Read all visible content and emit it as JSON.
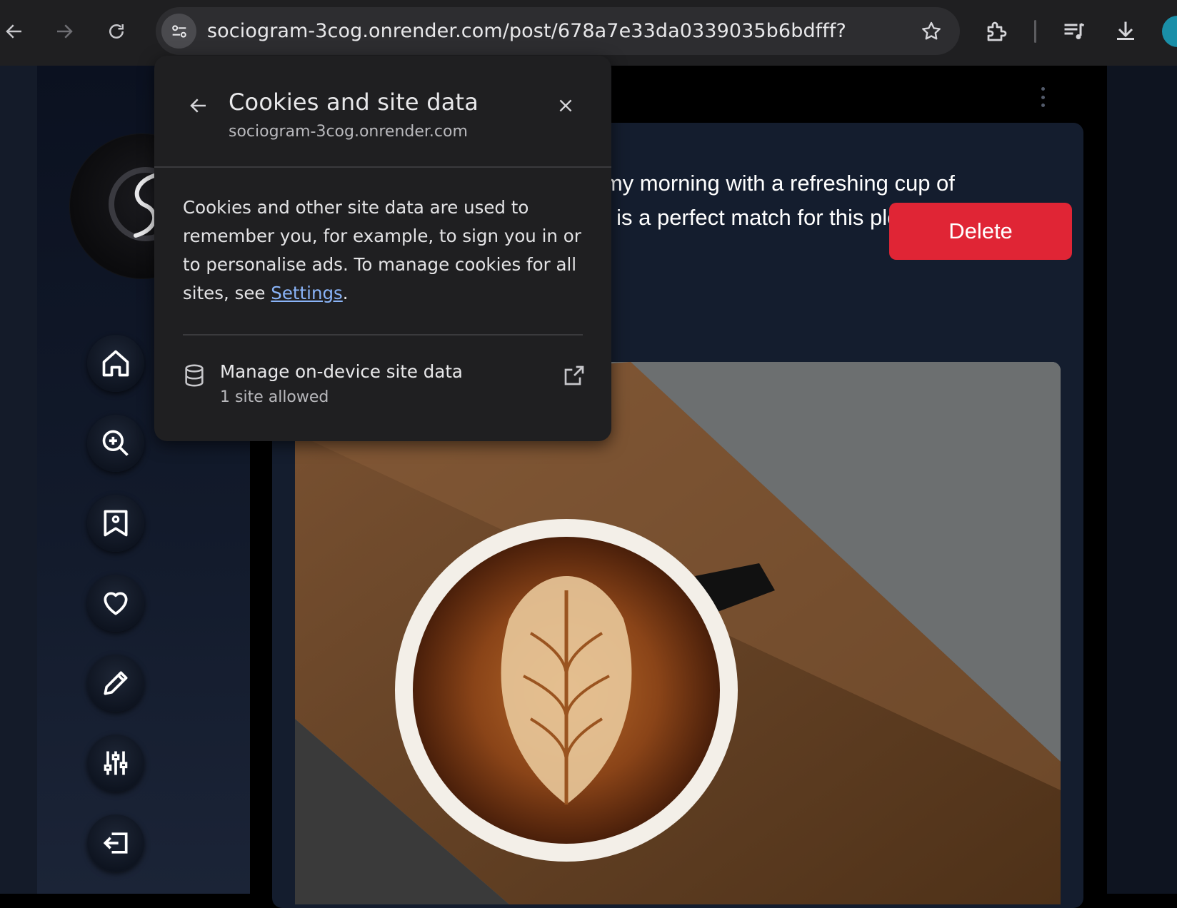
{
  "browser": {
    "url": "sociogram-3cog.onrender.com/post/678a7e33da0339035b6bdfff?",
    "icons": [
      "back-arrow-icon",
      "forward-arrow-icon",
      "reload-icon",
      "site-info-icon",
      "bookmark-star-icon",
      "extensions-puzzle-icon",
      "media-controls-icon",
      "download-icon",
      "profile-avatar"
    ]
  },
  "popup": {
    "title": "Cookies and site data",
    "domain": "sociogram-3cog.onrender.com",
    "description_prefix": "Cookies and other site data are used to remember you, for example, to sign you in or to personalise ads. To manage cookies for all sites, see ",
    "settings_link": "Settings",
    "description_suffix": ".",
    "manage_title": "Manage on-device site data",
    "manage_subtitle": "1 site allowed"
  },
  "post": {
    "text_line1": "d my morning with a refreshing cup of",
    "text_line2": "ee is a perfect match for this pleasant…",
    "delete_label": "Delete",
    "image_description": "latte-art-coffee-photo"
  },
  "sidebar": {
    "items": [
      {
        "name": "home",
        "icon": "home-icon"
      },
      {
        "name": "explore",
        "icon": "zoom-in-icon"
      },
      {
        "name": "saved",
        "icon": "bookmark-image-icon"
      },
      {
        "name": "liked",
        "icon": "heart-icon"
      },
      {
        "name": "create",
        "icon": "pencil-icon"
      },
      {
        "name": "settings",
        "icon": "sliders-icon"
      },
      {
        "name": "logout",
        "icon": "logout-icon"
      }
    ]
  },
  "colors": {
    "delete": "#e02535",
    "link": "#8ab4f8",
    "popup_bg": "#1f1f21",
    "card_bg": "#141d2e"
  }
}
